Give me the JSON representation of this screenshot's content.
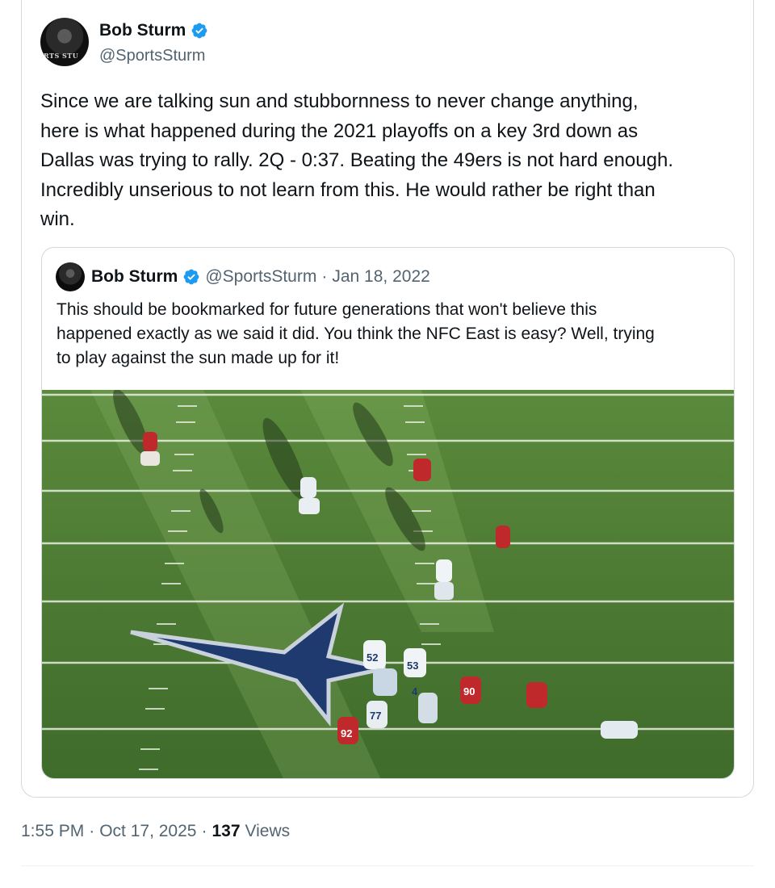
{
  "tweet": {
    "author": {
      "name": "Bob Sturm",
      "handle": "@SportsSturm",
      "avatar_text": "RTS STU",
      "verified": true
    },
    "text": "Since we are talking sun and stubbornness to never change anything,\nhere is what happened during the 2021 playoffs on a key 3rd down as\nDallas was trying to rally. 2Q - 0:37. Beating the 49ers is not hard enough.\nIncredibly unserious to not learn from this. He would rather be right than\nwin.",
    "quoted": {
      "author": {
        "name": "Bob Sturm",
        "handle": "@SportsSturm",
        "verified": true
      },
      "separator": "·",
      "date": "Jan 18, 2022",
      "text": "This should be bookmarked for future generations that won't believe this\nhappened exactly as we said it did. You think the NFC East is easy? Well, trying\nto play against the sun made up for it!",
      "media": {
        "description_icon": "football-field-image",
        "jersey_numbers": [
          "52",
          "53",
          "4",
          "77",
          "92",
          "90"
        ]
      }
    },
    "meta": {
      "time": "1:55 PM",
      "separator": "·",
      "date": "Oct 17, 2025",
      "views_count": "137",
      "views_label": "Views"
    }
  },
  "colors": {
    "verified_blue": "#1d9bf0",
    "secondary_text": "#536471",
    "border": "#cfd9de",
    "turf": "#4e7a34",
    "star": "#1e3a6e"
  }
}
